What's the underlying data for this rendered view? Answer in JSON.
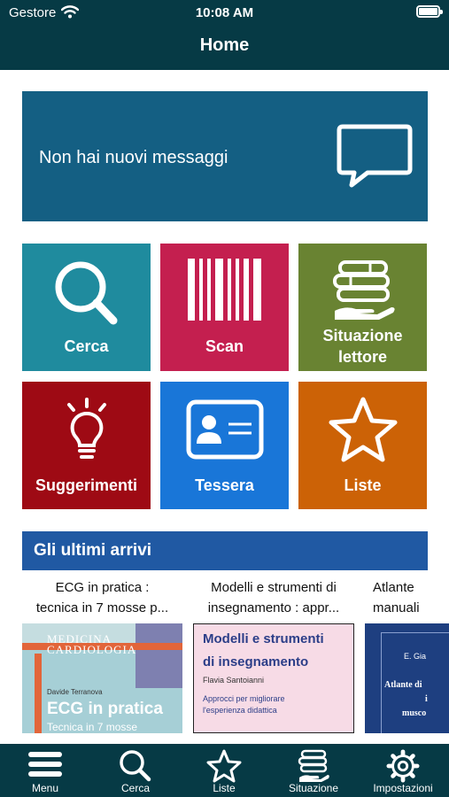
{
  "status_bar": {
    "carrier": "Gestore",
    "time": "10:08 AM"
  },
  "nav": {
    "title": "Home"
  },
  "messages": {
    "text": "Non hai nuovi messaggi",
    "icon": "speech-bubble-icon"
  },
  "tiles": [
    {
      "label": "Cerca",
      "icon": "search-icon",
      "color": "#1f8b9e"
    },
    {
      "label": "Scan",
      "icon": "barcode-icon",
      "color": "#c41f4f"
    },
    {
      "label": "Situazione lettore",
      "icon": "books-hand-icon",
      "color": "#698332"
    },
    {
      "label": "Suggerimenti",
      "icon": "lightbulb-icon",
      "color": "#9e0a14"
    },
    {
      "label": "Tessera",
      "icon": "id-card-icon",
      "color": "#1976d8"
    },
    {
      "label": "Liste",
      "icon": "star-icon",
      "color": "#cc6206"
    }
  ],
  "arrivals": {
    "heading": "Gli ultimi arrivi",
    "books": [
      {
        "title_line1": "ECG in pratica :",
        "title_line2": "tecnica  in 7 mosse p...",
        "cover_series": "MEDICINA",
        "cover_series2": "CARDIOLOGIA",
        "cover_author": "Davide Terranova",
        "cover_title": "ECG in pratica",
        "cover_subtitle": "Tecnica in 7 mosse"
      },
      {
        "title_line1": "Modelli e strumenti di",
        "title_line2": "insegnamento : appr...",
        "cover_title": "Modelli e strumenti di insegnamento",
        "cover_author": "Flavia Santoianni",
        "cover_subtitle": "Approcci per migliorare l'esperienza didattica"
      },
      {
        "title_line1": "Atlante",
        "title_line2": "manuali",
        "cover_author": "E. Gia",
        "cover_title": "Atlante di",
        "cover_line2": "i",
        "cover_line3": "musco"
      }
    ]
  },
  "tabbar": [
    {
      "label": "Menu",
      "icon": "hamburger-menu-icon"
    },
    {
      "label": "Cerca",
      "icon": "search-icon"
    },
    {
      "label": "Liste",
      "icon": "star-icon"
    },
    {
      "label": "Situazione",
      "icon": "books-hand-icon"
    },
    {
      "label": "Impostazioni",
      "icon": "gear-icon"
    }
  ],
  "colors": {
    "header": "#063a45",
    "message_banner": "#145f83",
    "arrivals_header": "#2059a3"
  }
}
